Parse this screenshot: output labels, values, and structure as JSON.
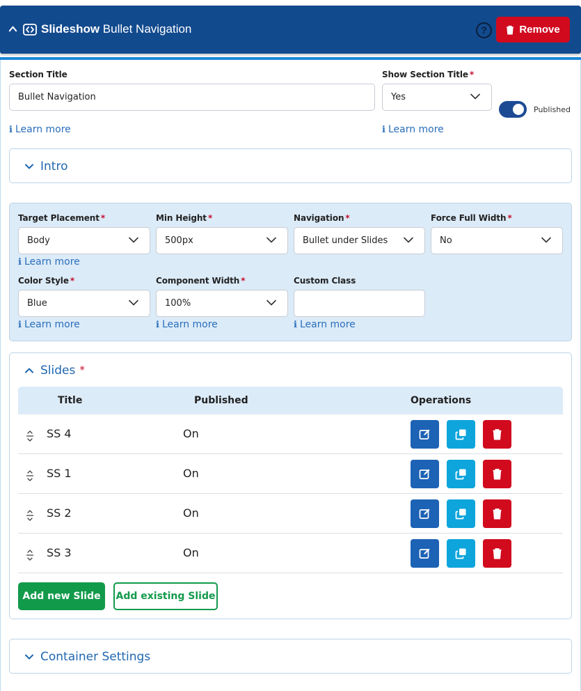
{
  "header": {
    "title_bold": "Slideshow",
    "title_rest": " Bullet Navigation",
    "help": "?",
    "remove_label": "Remove",
    "colors": {
      "bar": "#124a8e",
      "remove": "#d10a1e"
    }
  },
  "section_title": {
    "label": "Section Title",
    "value": "Bullet Navigation",
    "learn_more": "Learn more"
  },
  "show_section_title": {
    "label": "Show Section Title",
    "required": "*",
    "value": "Yes",
    "learn_more": "Learn more"
  },
  "published_toggle": {
    "label": "Published",
    "on": true
  },
  "intro": {
    "title": "Intro",
    "expanded": false
  },
  "options": {
    "target_placement": {
      "label": "Target Placement",
      "required": "*",
      "value": "Body",
      "learn_more": "Learn more"
    },
    "min_height": {
      "label": "Min Height",
      "required": "*",
      "value": "500px"
    },
    "navigation": {
      "label": "Navigation",
      "required": "*",
      "value": "Bullet under Slides"
    },
    "force_full_width": {
      "label": "Force Full Width",
      "required": "*",
      "value": "No"
    },
    "color_style": {
      "label": "Color Style",
      "required": "*",
      "value": "Blue",
      "learn_more": "Learn more"
    },
    "component_width": {
      "label": "Component Width",
      "required": "*",
      "value": "100%",
      "learn_more": "Learn more"
    },
    "custom_class": {
      "label": "Custom Class",
      "value": "",
      "learn_more": "Learn more"
    }
  },
  "slides": {
    "title": "Slides",
    "required": "*",
    "expanded": true,
    "columns": [
      "Title",
      "Published",
      "Operations"
    ],
    "rows": [
      {
        "title": "SS 4",
        "published": "On"
      },
      {
        "title": "SS 1",
        "published": "On"
      },
      {
        "title": "SS 2",
        "published": "On"
      },
      {
        "title": "SS 3",
        "published": "On"
      }
    ],
    "add_new_label": "Add new Slide",
    "add_existing_label": "Add existing Slide"
  },
  "container_settings": {
    "title": "Container Settings",
    "expanded": false
  },
  "icons": [
    "chevron-up-icon",
    "code-icon",
    "help-icon",
    "trash-icon",
    "chevron-down-icon",
    "drag-handle-icon",
    "edit-icon",
    "copy-icon"
  ]
}
